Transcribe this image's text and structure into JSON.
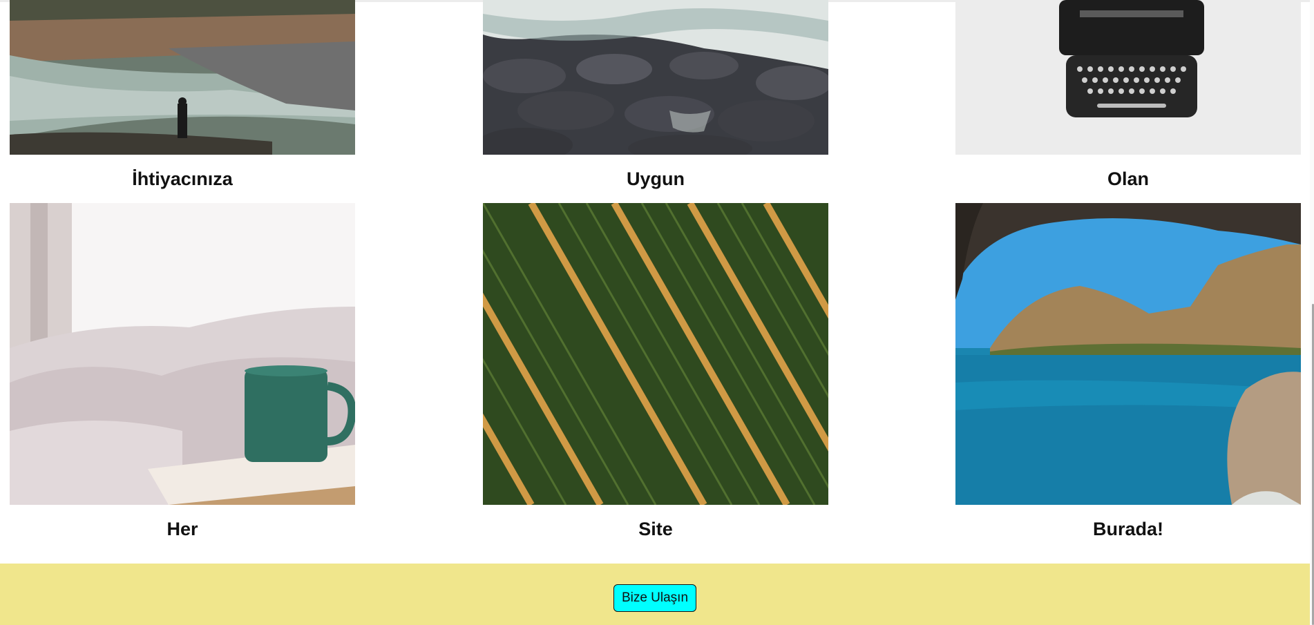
{
  "gallery": {
    "items": [
      {
        "caption": "İhtiyacınıza",
        "image": "river-rocks-person-photo"
      },
      {
        "caption": "Uygun",
        "image": "ocean-waves-rocks-photo"
      },
      {
        "caption": "Olan",
        "image": "typewriter-photo"
      },
      {
        "caption": "Her",
        "image": "coffee-mug-bed-photo"
      },
      {
        "caption": "Site",
        "image": "aerial-vineyard-rows-photo"
      },
      {
        "caption": "Burada!",
        "image": "sea-cave-cliffs-photo"
      }
    ]
  },
  "footer": {
    "contact_label": "Bize Ulaşın",
    "background_color": "#f0e68c",
    "button_color": "#00ffff"
  }
}
